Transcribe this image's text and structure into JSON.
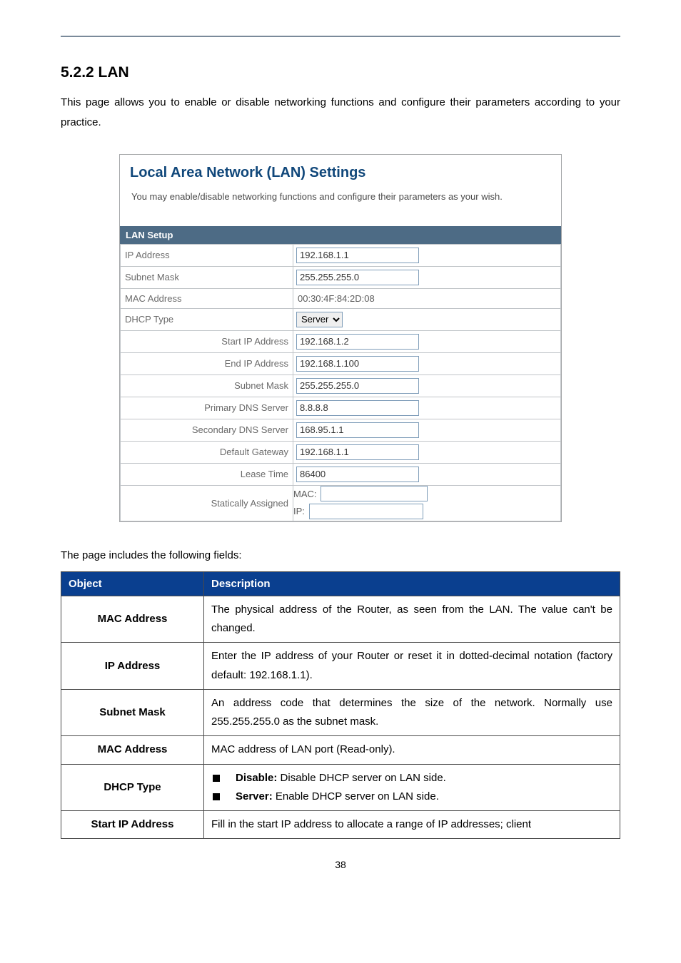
{
  "section": {
    "number_title": "5.2.2 LAN",
    "intro": "This page allows you to enable or disable networking functions and configure their parameters according to your practice."
  },
  "panel": {
    "title": "Local Area Network (LAN) Settings",
    "subtitle": "You may enable/disable networking functions and configure their parameters as your wish.",
    "section_bar": "LAN Setup",
    "rows": {
      "ip_address_label": "IP Address",
      "ip_address_value": "192.168.1.1",
      "subnet_mask_label": "Subnet Mask",
      "subnet_mask_value": "255.255.255.0",
      "mac_address_label": "MAC Address",
      "mac_address_value": "00:30:4F:84:2D:08",
      "dhcp_type_label": "DHCP Type",
      "dhcp_type_value": "Server",
      "start_ip_label": "Start IP Address",
      "start_ip_value": "192.168.1.2",
      "end_ip_label": "End IP Address",
      "end_ip_value": "192.168.1.100",
      "sm2_label": "Subnet Mask",
      "sm2_value": "255.255.255.0",
      "pdns_label": "Primary DNS Server",
      "pdns_value": "8.8.8.8",
      "sdns_label": "Secondary DNS Server",
      "sdns_value": "168.95.1.1",
      "gw_label": "Default Gateway",
      "gw_value": "192.168.1.1",
      "lease_label": "Lease Time",
      "lease_value": "86400",
      "static_label": "Statically Assigned",
      "static_mac_label": "MAC:",
      "static_mac_value": "",
      "static_ip_label": "IP:",
      "static_ip_value": ""
    }
  },
  "fields_intro": "The page includes the following fields:",
  "desc_table": {
    "headers": {
      "object": "Object",
      "description": "Description"
    },
    "rows": [
      {
        "object": "MAC Address",
        "desc_plain": "The physical address of the Router, as seen from the LAN. The value can't be changed."
      },
      {
        "object": "IP Address",
        "desc_plain": "Enter the IP address of your Router or reset it in dotted-decimal notation (factory default: 192.168.1.1)."
      },
      {
        "object": "Subnet Mask",
        "desc_plain": "An address code that determines the size of the network. Normally use 255.255.255.0 as the subnet mask."
      },
      {
        "object": "MAC Address",
        "desc_plain": "MAC address of LAN port (Read-only)."
      },
      {
        "object": "DHCP Type",
        "bullets": [
          {
            "bold": "Disable:",
            "rest": " Disable DHCP server on LAN side."
          },
          {
            "bold": "Server:",
            "rest": " Enable DHCP server on LAN side."
          }
        ]
      },
      {
        "object": "Start IP Address",
        "desc_plain": "Fill in the start IP address to allocate a range of IP addresses; client"
      }
    ]
  },
  "page_number": "38"
}
